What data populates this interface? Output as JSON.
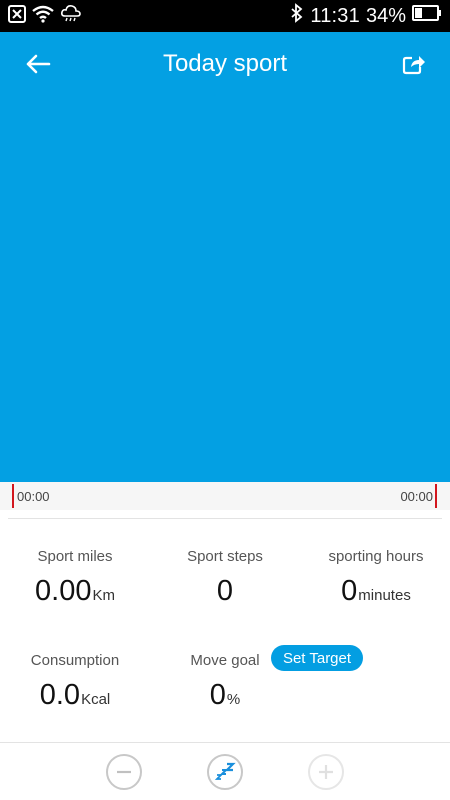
{
  "status_bar": {
    "time": "11:31",
    "battery_percent": "34%",
    "icons": [
      "close-notification-icon",
      "wifi-icon",
      "cloud-rain-icon",
      "bluetooth-icon",
      "battery-icon"
    ]
  },
  "header": {
    "title": "Today sport",
    "back_icon": "arrow-left-icon",
    "share_icon": "share-icon",
    "background": "#03A0E3"
  },
  "timeline": {
    "start": "00:00",
    "end": "00:00",
    "marker_color": "#d2161e"
  },
  "stats": {
    "miles": {
      "label": "Sport miles",
      "value": "0.00",
      "unit": "Km"
    },
    "steps": {
      "label": "Sport steps",
      "value": "0"
    },
    "hours": {
      "label": "sporting hours",
      "value": "0",
      "unit": "minutes"
    },
    "consumption": {
      "label": "Consumption",
      "value": "0.0",
      "unit": "Kcal"
    },
    "goal": {
      "label": "Move goal",
      "value": "0",
      "unit": "%"
    }
  },
  "set_target": {
    "label": "Set Target",
    "color": "#039EE2"
  },
  "controls": {
    "minus_icon": "minus-circle-icon",
    "sleep_icon": "sleep-zzz-icon",
    "plus_icon": "plus-circle-icon"
  }
}
